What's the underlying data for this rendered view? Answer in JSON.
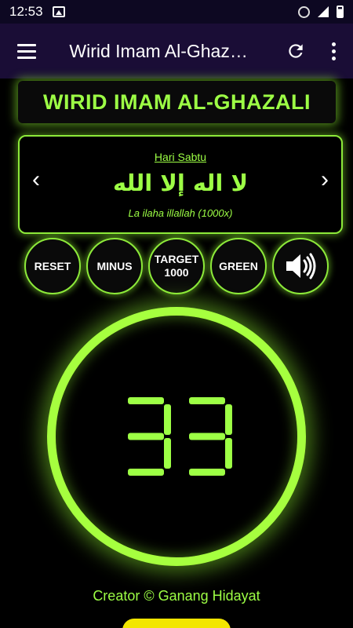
{
  "status_bar": {
    "time": "12:53",
    "icons": [
      "image-icon",
      "alarm-icon",
      "signal-icon",
      "battery-icon"
    ]
  },
  "app_bar": {
    "title": "Wirid Imam Al-Ghaz…",
    "icons": [
      "menu-icon",
      "refresh-icon",
      "more-vert-icon"
    ]
  },
  "header": {
    "title": "WIRID IMAM AL-GHAZALI"
  },
  "wirid": {
    "day": "Hari Sabtu",
    "arabic": "لا اله إلا الله",
    "latin": "La ilaha illallah (1000x)",
    "prev_glyph": "‹",
    "next_glyph": "›"
  },
  "buttons": {
    "reset": "RESET",
    "minus": "MINUS",
    "target_label": "TARGET",
    "target_value": "1000",
    "green": "GREEN",
    "sound_icon": "speaker-icon"
  },
  "counter": {
    "value": "33"
  },
  "footer": {
    "creator": "Creator © Ganang Hidayat"
  },
  "colors": {
    "accent": "#9dff45",
    "ring": "#a6ff3f",
    "app_bar": "#1a0d36",
    "status_bar": "#0d0822",
    "background": "#000000",
    "yellow_button": "#f2e600"
  }
}
